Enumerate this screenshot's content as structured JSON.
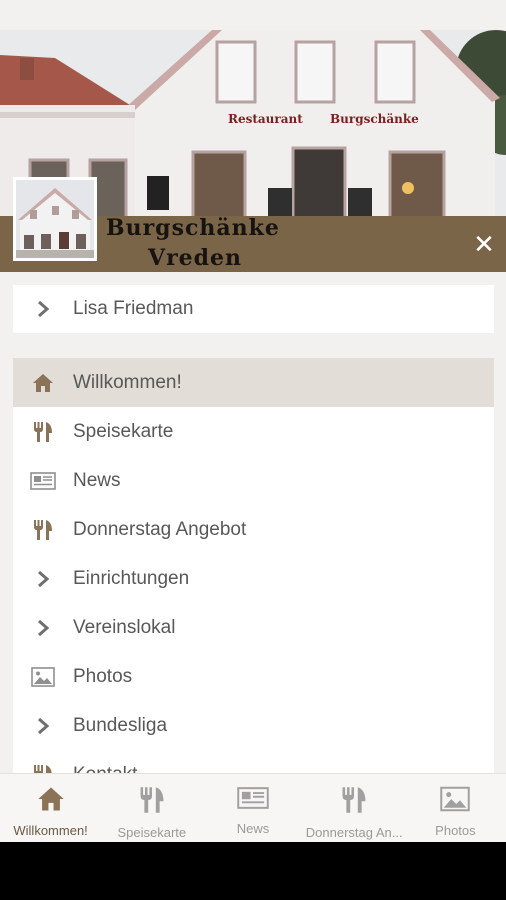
{
  "header": {
    "brand_line1": "Burgschänke",
    "brand_line2": "Vreden",
    "sign_left": "Restaurant",
    "sign_right": "Burgschänke",
    "close_icon": "close-icon",
    "accent_color": "#7b6548"
  },
  "user": {
    "name": "Lisa Friedman",
    "icon": "chevron-right-icon"
  },
  "menu": {
    "items": [
      {
        "label": "Willkommen!",
        "icon": "home-icon",
        "active": true
      },
      {
        "label": "Speisekarte",
        "icon": "cutlery-icon"
      },
      {
        "label": "News",
        "icon": "newspaper-icon"
      },
      {
        "label": "Donnerstag Angebot",
        "icon": "cutlery-icon"
      },
      {
        "label": "Einrichtungen",
        "icon": "chevron-right-icon"
      },
      {
        "label": "Vereinslokal",
        "icon": "chevron-right-icon"
      },
      {
        "label": "Photos",
        "icon": "image-icon"
      },
      {
        "label": "Bundesliga",
        "icon": "chevron-right-icon"
      },
      {
        "label": "Kontakt",
        "icon": "cutlery-icon"
      }
    ]
  },
  "tabs": [
    {
      "label": "Willkommen!",
      "icon": "home-icon",
      "active": true
    },
    {
      "label": "Speisekarte",
      "icon": "cutlery-icon"
    },
    {
      "label": "News",
      "icon": "newspaper-icon"
    },
    {
      "label": "Donnerstag An...",
      "icon": "cutlery-icon"
    },
    {
      "label": "Photos",
      "icon": "image-icon"
    }
  ]
}
